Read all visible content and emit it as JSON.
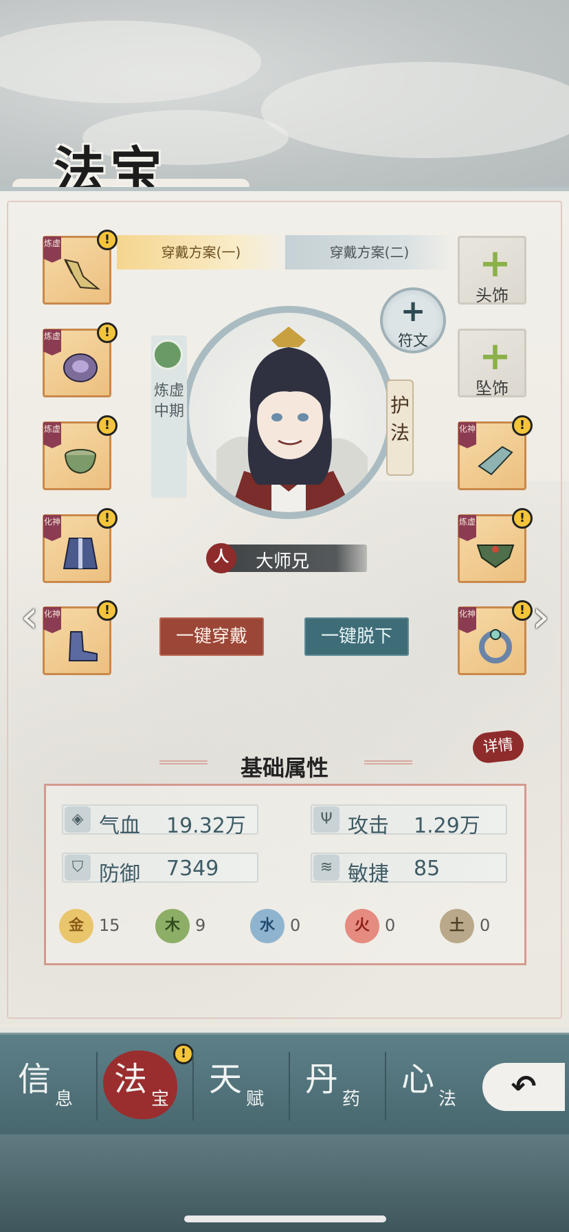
{
  "page_title": "法宝",
  "tabs": [
    {
      "label": "穿戴方案(一)",
      "active": true
    },
    {
      "label": "穿戴方案(二)",
      "active": false
    }
  ],
  "left_slots": [
    {
      "tag": "炼虚",
      "icon": "sword-blade-icon",
      "alert": "!"
    },
    {
      "tag": "炼虚",
      "icon": "purple-armor-icon",
      "alert": "!"
    },
    {
      "tag": "炼虚",
      "icon": "jade-cauldron-icon",
      "alert": "!"
    },
    {
      "tag": "化神",
      "icon": "blue-robe-icon",
      "alert": "!"
    },
    {
      "tag": "化神",
      "icon": "blue-boots-icon",
      "alert": "!"
    }
  ],
  "right_empty_slots": [
    {
      "label": "头饰",
      "icon": "plus-icon"
    },
    {
      "label": "坠饰",
      "icon": "plus-icon"
    }
  ],
  "right_slots": [
    {
      "tag": "化神",
      "icon": "jade-bracer-icon",
      "alert": "!"
    },
    {
      "tag": "炼虚",
      "icon": "green-belt-icon",
      "alert": "!"
    },
    {
      "tag": "化神",
      "icon": "gem-ring-icon",
      "alert": "!"
    }
  ],
  "rune": {
    "label": "符文",
    "icon": "plus-icon"
  },
  "realm": {
    "label": "炼虚中期"
  },
  "guard": {
    "label": "护法"
  },
  "character": {
    "race_tag": "人",
    "name": "大师兄"
  },
  "actions": {
    "equip_all": "一键穿戴",
    "unequip_all": "一键脱下"
  },
  "detail_label": "详情",
  "stats_section": {
    "title": "基础属性",
    "stats": [
      {
        "name": "气血",
        "value": "19.32万",
        "icon": "blood-drop-icon"
      },
      {
        "name": "攻击",
        "value": "1.29万",
        "icon": "attack-icon"
      },
      {
        "name": "防御",
        "value": "7349",
        "icon": "shield-icon"
      },
      {
        "name": "敏捷",
        "value": "85",
        "icon": "wing-icon"
      }
    ],
    "elements": [
      {
        "glyph": "金",
        "value": "15",
        "color": "#e9c56c"
      },
      {
        "glyph": "木",
        "value": "9",
        "color": "#8cae66"
      },
      {
        "glyph": "水",
        "value": "0",
        "color": "#8fb4cf"
      },
      {
        "glyph": "火",
        "value": "0",
        "color": "#e58b7f"
      },
      {
        "glyph": "土",
        "value": "0",
        "color": "#b9a98a"
      }
    ]
  },
  "nav": [
    {
      "main": "信",
      "sub": "息"
    },
    {
      "main": "法",
      "sub": "宝",
      "active": true,
      "alert": "!"
    },
    {
      "main": "天",
      "sub": "赋"
    },
    {
      "main": "丹",
      "sub": "药"
    },
    {
      "main": "心",
      "sub": "法"
    }
  ],
  "colors": {
    "accent_red": "#9b4637",
    "accent_teal": "#3e6d78",
    "slot_border": "#c9884a"
  }
}
